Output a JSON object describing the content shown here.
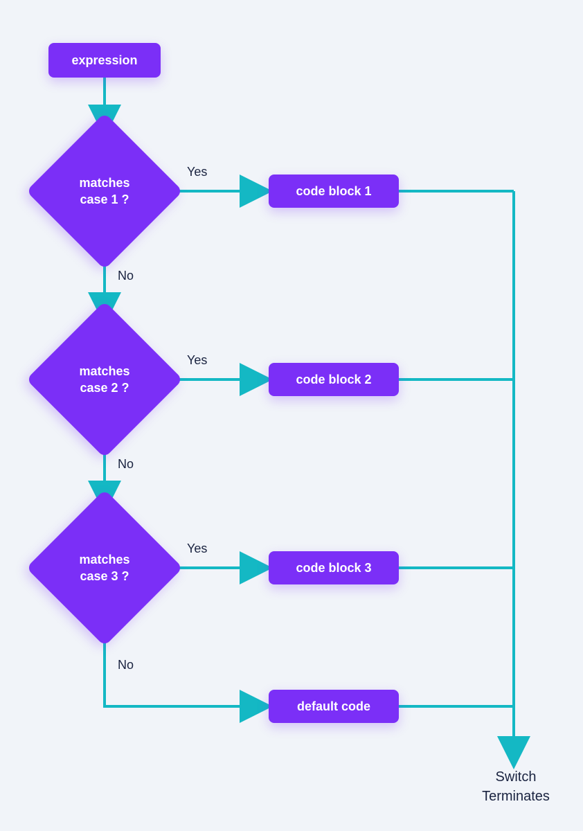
{
  "start": {
    "label": "expression"
  },
  "decisions": [
    {
      "label": "matches\ncase 1 ?",
      "yes_label": "Yes",
      "no_label": "No",
      "block_label": "code block 1"
    },
    {
      "label": "matches\ncase 2 ?",
      "yes_label": "Yes",
      "no_label": "No",
      "block_label": "code block 2"
    },
    {
      "label": "matches\ncase 3 ?",
      "yes_label": "Yes",
      "no_label": "No",
      "block_label": "code block 3"
    }
  ],
  "default_block": {
    "label": "default code"
  },
  "end": {
    "label": "Switch\nTerminates"
  },
  "colors": {
    "node_fill": "#7b2ff7",
    "node_text": "#ffffff",
    "flow_line": "#14b8c4",
    "label_text": "#1a2340",
    "background": "#f1f4f9"
  }
}
